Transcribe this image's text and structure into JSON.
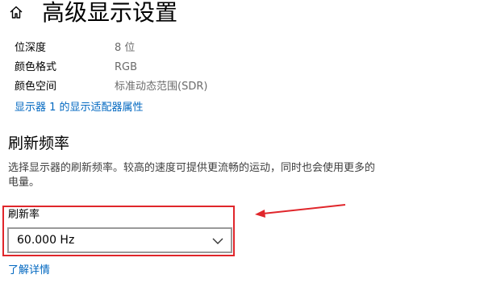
{
  "header": {
    "title": "高级显示设置",
    "home_icon": "home-icon"
  },
  "display_info": [
    {
      "label": "位深度",
      "value": "8 位"
    },
    {
      "label": "颜色格式",
      "value": "RGB"
    },
    {
      "label": "颜色空间",
      "value": "标准动态范围(SDR)"
    }
  ],
  "adapter_link": "显示器 1 的显示适配器属性",
  "refresh": {
    "section_title": "刷新频率",
    "description": "选择显示器的刷新频率。较高的速度可提供更流畅的运动，同时也会使用更多的电量。",
    "field_label": "刷新率",
    "selected_value": "60.000 Hz",
    "learn_more": "了解详情"
  },
  "colors": {
    "annotation": "#e0262b",
    "link": "#0067c0"
  }
}
